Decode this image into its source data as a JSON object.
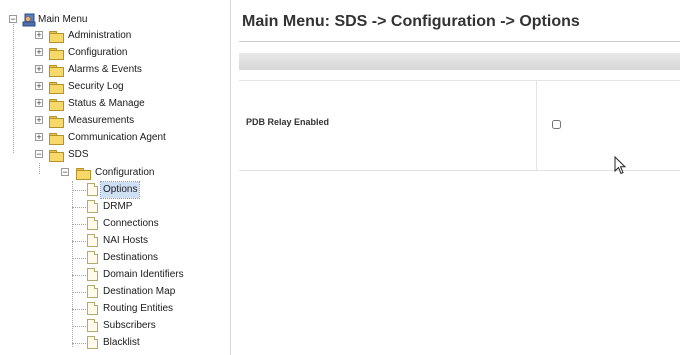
{
  "tree": {
    "root": {
      "label": "Main Menu",
      "toggle": "−"
    },
    "items": [
      {
        "label": "Administration",
        "toggle": "+"
      },
      {
        "label": "Configuration",
        "toggle": "+"
      },
      {
        "label": "Alarms & Events",
        "toggle": "+"
      },
      {
        "label": "Security Log",
        "toggle": "+"
      },
      {
        "label": "Status & Manage",
        "toggle": "+"
      },
      {
        "label": "Measurements",
        "toggle": "+"
      },
      {
        "label": "Communication Agent",
        "toggle": "+"
      },
      {
        "label": "SDS",
        "toggle": "−"
      }
    ],
    "sds_configuration": {
      "label": "Configuration",
      "toggle": "−"
    },
    "config_items": [
      {
        "label": "Options",
        "selected": true
      },
      {
        "label": "DRMP"
      },
      {
        "label": "Connections"
      },
      {
        "label": "NAI Hosts"
      },
      {
        "label": "Destinations"
      },
      {
        "label": "Domain Identifiers"
      },
      {
        "label": "Destination Map"
      },
      {
        "label": "Routing Entities"
      },
      {
        "label": "Subscribers"
      },
      {
        "label": "Blacklist"
      }
    ]
  },
  "main": {
    "title": "Main Menu: SDS -> Configuration -> Options",
    "options": [
      {
        "label": "PDB Relay Enabled",
        "checked": false
      }
    ]
  },
  "icons": {
    "root": "main-menu-icon",
    "folder": "folder-icon",
    "open_folder": "folder-open-icon",
    "page": "page-icon",
    "cursor": "mouse-cursor-icon"
  },
  "colors": {
    "selected_bg": "#cfe0f5",
    "folder": "#f7d96a",
    "title_text": "#333333"
  }
}
